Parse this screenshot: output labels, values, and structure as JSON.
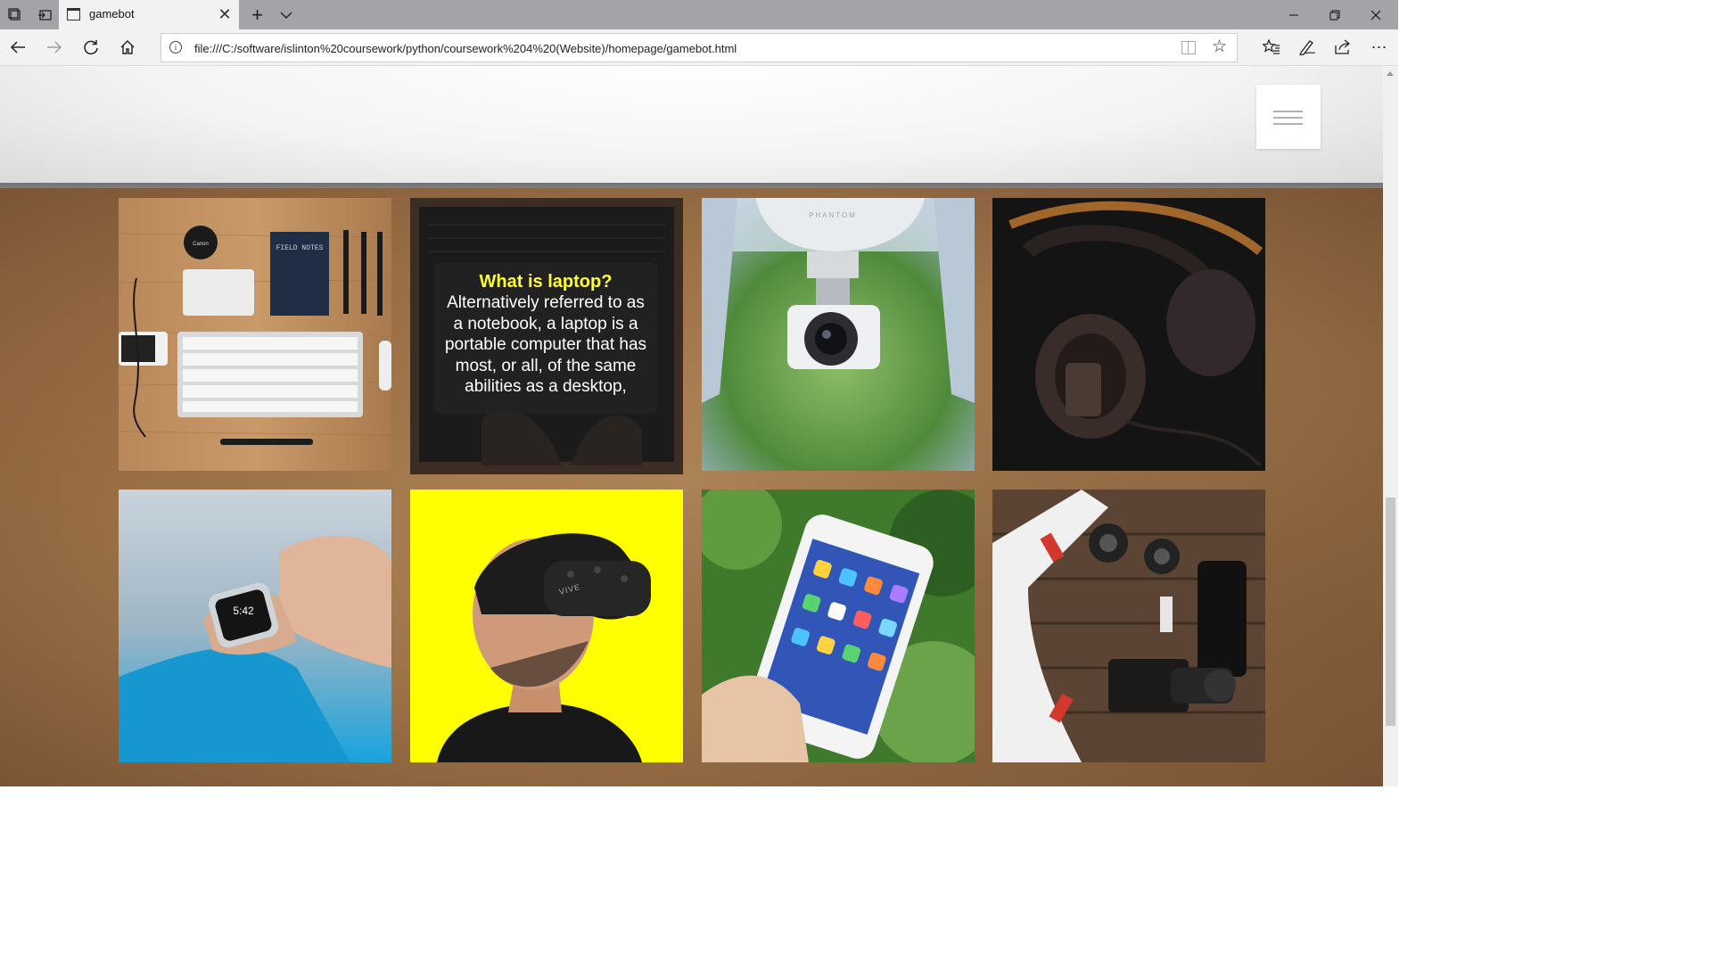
{
  "browser": {
    "tab_title": "gamebot",
    "url": "file:///C:/software/islinton%20coursework/python/coursework%204%20(Website)/homepage/gamebot.html"
  },
  "laptop_card": {
    "heading": "What is laptop?",
    "lines": [
      "Alternatively referred to as",
      "a notebook, a laptop is a",
      "portable computer that has",
      "most, or all, of the same",
      "abilities as a desktop,"
    ]
  },
  "photo_labels": {
    "field_notes": "FIELD NOTES",
    "canon": "Canon",
    "phantom": "PHANTOM",
    "vive": "VIVE",
    "watch_time": "5:42"
  },
  "colors": {
    "accent_yellow": "#ffff00",
    "heading_yellow": "#ffff33",
    "wood_brown": "#9c7248"
  }
}
